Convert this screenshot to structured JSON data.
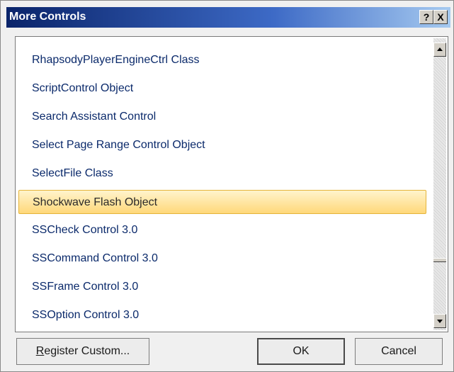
{
  "dialog": {
    "title": "More Controls",
    "help_label": "?",
    "close_label": "X"
  },
  "list": {
    "items": [
      "RhapsodyPlayerEngineCtrl Class",
      "ScriptControl Object",
      "Search Assistant Control",
      "Select Page Range Control Object",
      "SelectFile Class",
      "Shockwave Flash Object",
      "SSCheck Control 3.0",
      "SSCommand Control 3.0",
      "SSFrame Control 3.0",
      "SSOption Control 3.0"
    ],
    "selected": "Shockwave Flash Object"
  },
  "buttons": {
    "register_prefix": "R",
    "register_rest": "egister Custom...",
    "ok": "OK",
    "cancel": "Cancel"
  },
  "colors": {
    "title_gradient_start": "#0a246a",
    "selection_fill": "#ffd87a",
    "item_text": "#0b2a6b"
  }
}
